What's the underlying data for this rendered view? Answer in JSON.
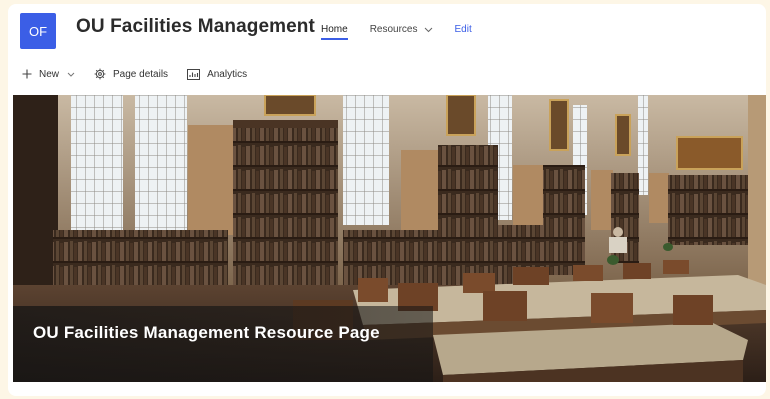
{
  "site": {
    "logo_text": "OF",
    "title": "OU Facilities Management",
    "brand_color": "#3b5ee6"
  },
  "nav": {
    "home": "Home",
    "resources": "Resources",
    "edit": "Edit",
    "chevron_icon": "chevron-down-icon"
  },
  "toolbar": {
    "new_label": "New",
    "page_details_label": "Page details",
    "analytics_label": "Analytics",
    "icons": [
      "plus-icon",
      "gear-icon",
      "analytics-icon"
    ]
  },
  "hero": {
    "title": "OU Facilities Management Resource Page",
    "image_subject": "library-reading-room"
  }
}
